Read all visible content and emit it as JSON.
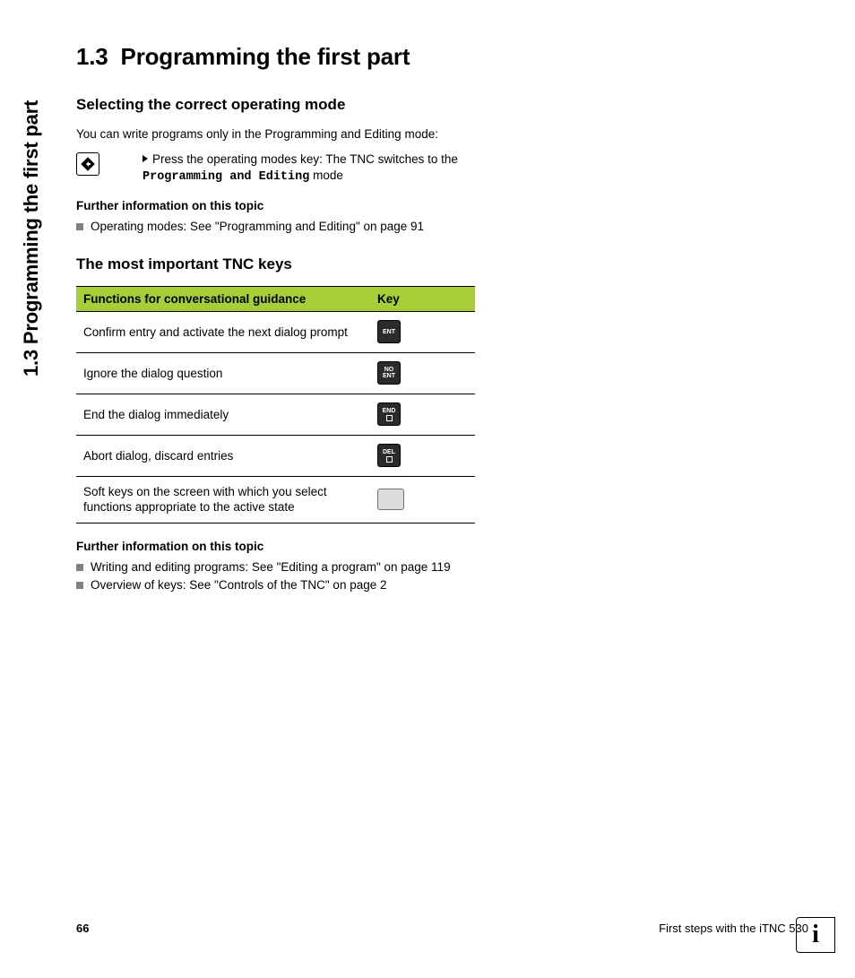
{
  "sideTitle": "1.3 Programming the first part",
  "heading": {
    "num": "1.3",
    "title": "Programming the first part"
  },
  "section1": {
    "title": "Selecting the correct operating mode",
    "intro": "You can write programs only in the Programming and Editing mode:",
    "step": {
      "pre": "Press the operating modes key: The TNC switches to the ",
      "mono": "Programming and Editing",
      "post": " mode"
    },
    "furtherHead": "Further information on this topic",
    "furtherItems": [
      "Operating modes: See \"Programming and Editing\" on page 91"
    ]
  },
  "section2": {
    "title": "The most important TNC keys",
    "table": {
      "headFunc": "Functions for conversational guidance",
      "headKey": "Key",
      "rows": [
        {
          "func": "Confirm entry and activate the next dialog prompt",
          "key": {
            "label": "ENT",
            "variant": "dark"
          }
        },
        {
          "func": "Ignore the dialog question",
          "key": {
            "label": "NO\nENT",
            "variant": "dark-lines"
          }
        },
        {
          "func": "End the dialog immediately",
          "key": {
            "label": "END",
            "variant": "dark-sq"
          }
        },
        {
          "func": "Abort dialog, discard entries",
          "key": {
            "label": "DEL",
            "variant": "dark-sq"
          }
        },
        {
          "func": "Soft keys on the screen with which you select functions appropriate to the active state",
          "key": {
            "label": "",
            "variant": "light"
          }
        }
      ]
    },
    "furtherHead": "Further information on this topic",
    "furtherItems": [
      "Writing and editing programs: See \"Editing a program\" on page 119",
      "Overview of keys: See \"Controls of the TNC\" on page 2"
    ]
  },
  "footer": {
    "page": "66",
    "chapter": "First steps with the iTNC 530"
  }
}
